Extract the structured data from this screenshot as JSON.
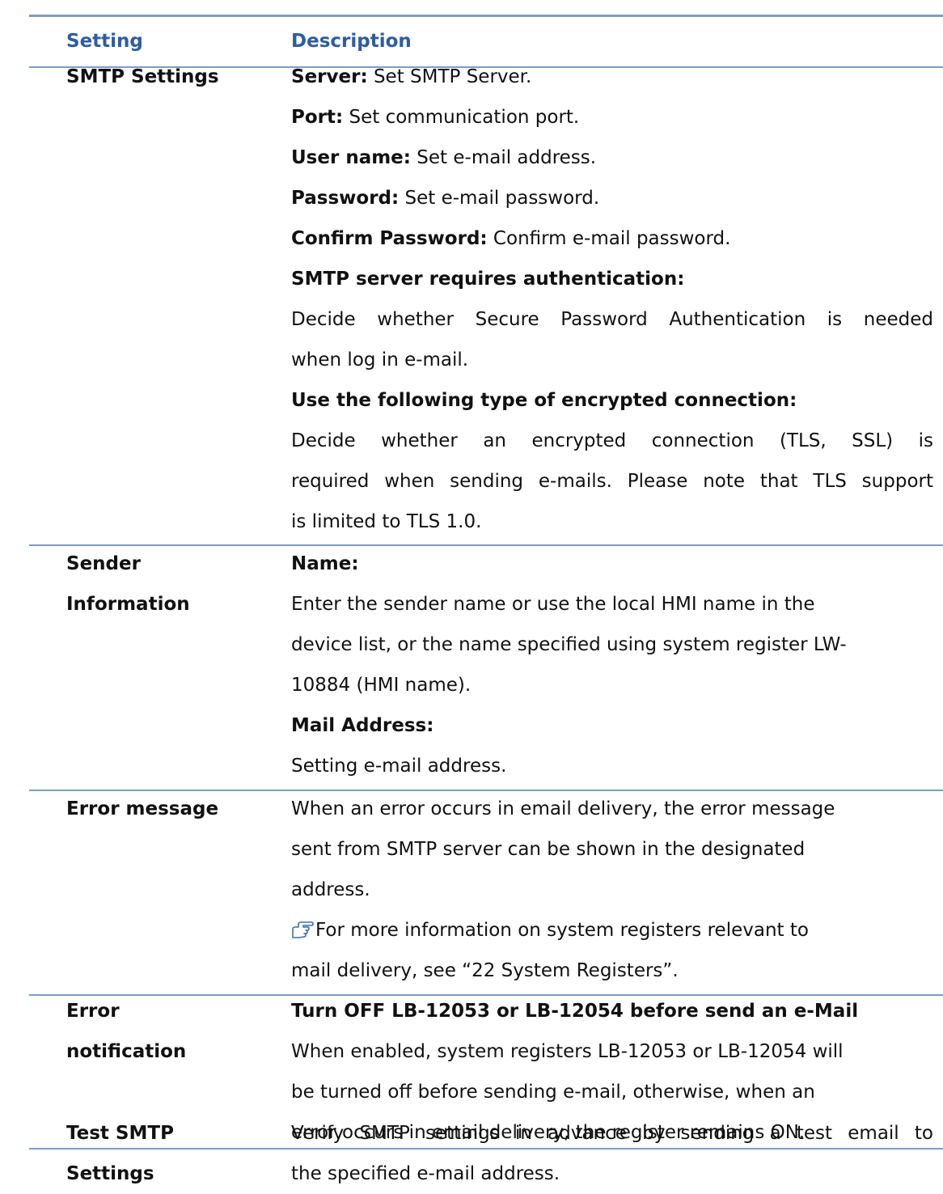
{
  "header": {
    "setting": "Setting",
    "description": "Description"
  },
  "rows": [
    {
      "label_lines": [
        "SMTP Settings"
      ],
      "desc": [
        {
          "bold": "Server:",
          "text": " Set SMTP Server."
        },
        {
          "bold": "Port:",
          "text": " Set communication port."
        },
        {
          "bold": "User name:",
          "text": " Set e-mail address."
        },
        {
          "bold": "Password:",
          "text": " Set e-mail password."
        },
        {
          "bold": "Confirm Password:",
          "text": " Confirm e-mail password."
        },
        {
          "bold": "SMTP server requires authentication:",
          "text": ""
        },
        {
          "text": "Decide whether Secure Password Authentication is needed"
        },
        {
          "text": "when log in e-mail."
        },
        {
          "bold": "Use the following type of encrypted connection:",
          "text": ""
        },
        {
          "text": "Decide whether an encrypted connection (TLS, SSL) is"
        },
        {
          "text": "required when sending e-mails. Please note that TLS support"
        },
        {
          "text": "is limited to TLS 1.0."
        }
      ]
    },
    {
      "label_lines": [
        "Sender",
        "Information"
      ],
      "desc": [
        {
          "bold": "Name:",
          "text": ""
        },
        {
          "text": "Enter the sender name or use the local HMI name in the"
        },
        {
          "text": "device list, or the name specified using system register LW-"
        },
        {
          "text": "10884 (HMI name)."
        },
        {
          "bold": "Mail Address:",
          "text": ""
        },
        {
          "text": "Setting e-mail address."
        }
      ]
    },
    {
      "label_lines": [
        "Error message"
      ],
      "desc": [
        {
          "text": "When an error occurs in email delivery, the error message"
        },
        {
          "text": "sent from SMTP server can be shown in the designated"
        },
        {
          "text": "address."
        },
        {
          "text": "For more information on system registers relevant to"
        },
        {
          "text": "mail delivery, see “22 System Registers”."
        }
      ],
      "note_icon": "pointing-hand-icon"
    },
    {
      "label_lines": [
        "Error",
        "notification"
      ],
      "desc": [
        {
          "bold": "Turn OFF LB-12053 or LB-12054 before send an e-Mail",
          "text": ""
        },
        {
          "text": "When enabled, system registers LB-12053 or LB-12054 will"
        },
        {
          "text": "be turned off before sending e-mail, otherwise, when an"
        },
        {
          "text": "error occurs in email delivery, the register remains ON."
        }
      ]
    },
    {
      "label_lines": [
        "Test SMTP",
        "Settings"
      ],
      "desc": [
        {
          "text": "Verify SMTP settings in advance by sending a test email to"
        },
        {
          "text": "the specified e-mail address."
        }
      ]
    }
  ]
}
